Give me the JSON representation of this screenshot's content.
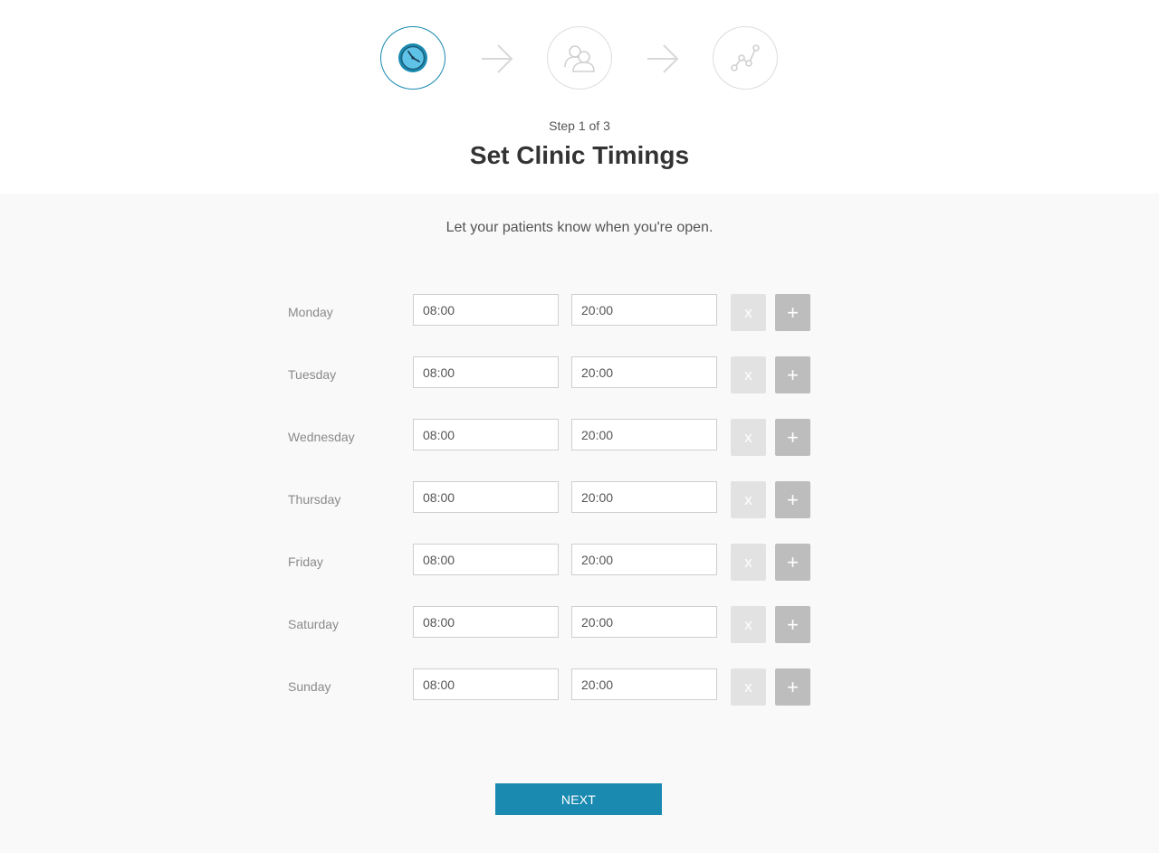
{
  "wizard": {
    "steps": [
      {
        "icon": "clock-icon",
        "active": true
      },
      {
        "icon": "users-icon",
        "active": false
      },
      {
        "icon": "chart-line-icon",
        "active": false
      }
    ],
    "step_count": "Step 1 of 3",
    "title": "Set Clinic Timings",
    "subtitle": "Let your patients know when you're open."
  },
  "schedule": {
    "days": [
      {
        "day": "Monday",
        "start": "08:00",
        "end": "20:00"
      },
      {
        "day": "Tuesday",
        "start": "08:00",
        "end": "20:00"
      },
      {
        "day": "Wednesday",
        "start": "08:00",
        "end": "20:00"
      },
      {
        "day": "Thursday",
        "start": "08:00",
        "end": "20:00"
      },
      {
        "day": "Friday",
        "start": "08:00",
        "end": "20:00"
      },
      {
        "day": "Saturday",
        "start": "08:00",
        "end": "20:00"
      },
      {
        "day": "Sunday",
        "start": "08:00",
        "end": "20:00"
      }
    ],
    "remove_label": "x",
    "add_label": "+"
  },
  "actions": {
    "next_label": "NEXT"
  },
  "colors": {
    "accent": "#1a8ab0",
    "remove_button": "#e2e2e2",
    "add_button": "#bdbdbd"
  }
}
